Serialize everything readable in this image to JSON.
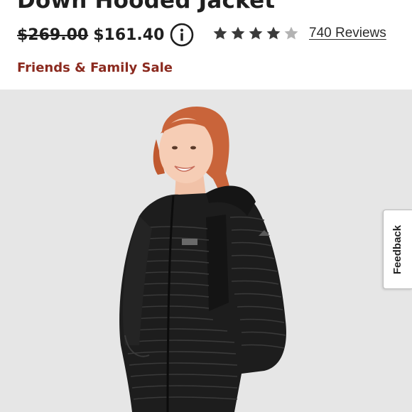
{
  "product": {
    "title": "Down Hooded Jacket",
    "original_price": "$269.00",
    "sale_price": "$161.40",
    "info_icon": "info-icon",
    "rating_stars": 4.5,
    "rating_max": 5,
    "reviews_link": "740 Reviews",
    "promo_label": "Friends & Family Sale"
  },
  "image": {
    "description_icon": "product-photo",
    "background_color": "#e6e6e6"
  },
  "feedback_tab": {
    "label": "Feedback"
  },
  "colors": {
    "promo_text": "#8b2a1f",
    "star_filled": "#3a3a3a",
    "star_empty": "#b3b3b3"
  }
}
